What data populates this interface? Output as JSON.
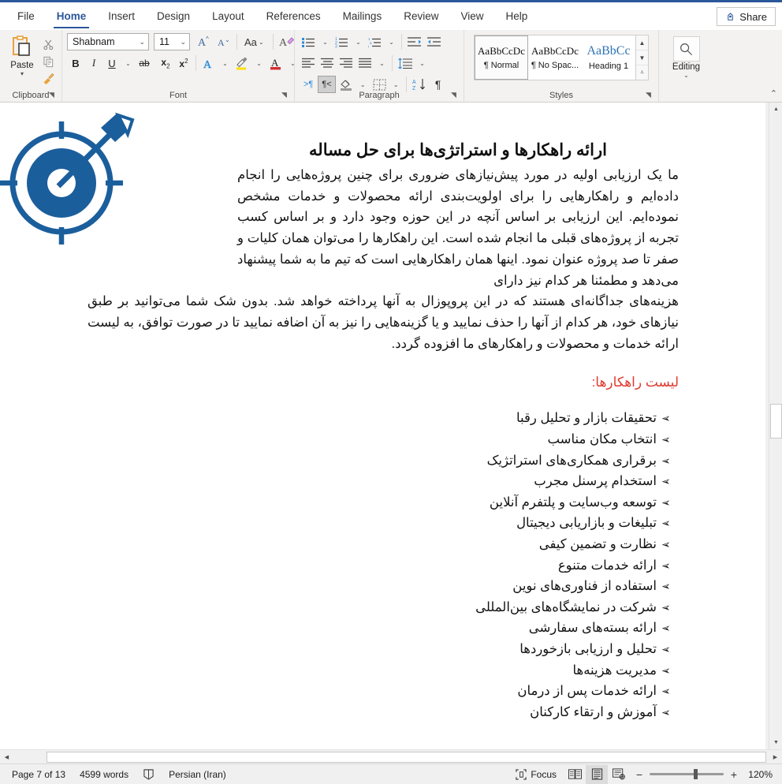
{
  "titlebar": {
    "tabs": [
      "File",
      "Home",
      "Insert",
      "Design",
      "Layout",
      "References",
      "Mailings",
      "Review",
      "View",
      "Help"
    ],
    "active_tab": "Home",
    "share_label": "Share",
    "share_icon": "share-person-icon"
  },
  "ribbon": {
    "groups": [
      {
        "name": "Clipboard",
        "label": "Clipboard",
        "paste_label": "Paste",
        "paste_icon": "clipboard-paste-icon",
        "cut_icon": "scissors-icon",
        "copy_icon": "copy-icon",
        "format_painter_icon": "paintbrush-icon",
        "dialog_launcher_icon": "dialog-launcher-icon"
      },
      {
        "name": "Font",
        "label": "Font",
        "font_name": "Shabnam",
        "font_size": "11",
        "grow_font_icon": "grow-font-icon",
        "shrink_font_icon": "shrink-font-icon",
        "change_case_label": "Aa",
        "change_case_icon": "change-case-icon",
        "clear_formatting_icon": "clear-formatting-icon",
        "bold_label": "B",
        "italic_label": "I",
        "underline_label": "U",
        "strikethrough_label": "ab",
        "subscript_label": "x",
        "subscript_sub": "2",
        "superscript_label": "x",
        "superscript_sup": "2",
        "text_effects_label": "A",
        "text_effects_icon": "text-effects-icon",
        "highlight_label": "A",
        "highlight_icon": "text-highlight-icon",
        "font_color_label": "A",
        "font_color_icon": "font-color-icon",
        "dialog_launcher_icon": "dialog-launcher-icon"
      },
      {
        "name": "Paragraph",
        "label": "Paragraph",
        "bullets_icon": "bullet-list-icon",
        "numbering_icon": "numbered-list-icon",
        "multilevel_icon": "multilevel-list-icon",
        "decrease_indent_icon": "decrease-indent-icon",
        "increase_indent_icon": "increase-indent-icon",
        "align_left_icon": "align-left-icon",
        "align_center_icon": "align-center-icon",
        "align_right_icon": "align-right-icon",
        "justify_icon": "justify-icon",
        "line_spacing_icon": "line-spacing-icon",
        "ltr_icon": "left-to-right-text-icon",
        "rtl_icon": "right-to-left-text-icon",
        "rtl_pressed": true,
        "shading_icon": "shading-icon",
        "borders_icon": "borders-icon",
        "sort_icon": "sort-az-icon",
        "show_marks_icon": "show-formatting-marks-icon",
        "dialog_launcher_icon": "dialog-launcher-icon"
      },
      {
        "name": "Styles",
        "label": "Styles",
        "items": [
          {
            "preview": "AaBbCcDc",
            "name": "¶ Normal",
            "selected": true
          },
          {
            "preview": "AaBbCcDc",
            "name": "¶ No Spac...",
            "selected": false
          },
          {
            "preview": "AaBbCc",
            "name": "Heading 1",
            "selected": false
          }
        ],
        "scroll_up_icon": "chevron-up-icon",
        "scroll_down_icon": "chevron-down-icon",
        "more_icon": "gallery-more-icon",
        "dialog_launcher_icon": "dialog-launcher-icon"
      },
      {
        "name": "Editing",
        "label": "Editing",
        "icon": "magnifier-icon",
        "dropdown_icon": "chevron-down-icon"
      }
    ],
    "collapse_icon": "collapse-ribbon-icon"
  },
  "document": {
    "title": "ارائه راهکارها و استراتژی‌ها برای حل مساله",
    "image_alt": "target-with-arrow-graphic",
    "image_color": "#1b5e9c",
    "paragraph_wrapped": "ما یک ارزیابی اولیه در مورد پیش‌نیازهای ضروری برای چنین پروژه‌هایی را انجام داده‌ایم و راهکارهایی را برای اولویت‌بندی ارائه محصولات و خدمات مشخص نموده‌ایم. این ارزیابی بر اساس آنچه در این حوزه وجود دارد و بر اساس کسب تجربه از پروژه‌های قبلی ما انجام شده است. این راهکارها را می‌توان همان کلیات و صفر تا صد پروژه عنوان نمود. اینها همان راهکارهایی است که تیم ما به شما پیشنهاد می‌دهد و مطمئنا هر کدام نیز دارای",
    "paragraph_full": "هزینه‌های جداگانه‌ای هستند که در این پروپوزال به آنها پرداخته خواهد شد. بدون شک شما می‌توانید بر طبق نیازهای خود، هر کدام از آنها را حذف نمایید و یا گزینه‌هایی را نیز به آن اضافه نمایید تا در صورت توافق، به لیست ارائه خدمات و محصولات و راهکارهای ما افزوده گردد.",
    "list_heading": "لیست راهکارها:",
    "list_heading_color": "#e03a2f",
    "bullet_marker": "➢",
    "bullets": [
      "تحقیقات بازار و تحلیل رقبا",
      "انتخاب مکان مناسب",
      "برقراری همکاری‌های استراتژیک",
      "استخدام پرسنل مجرب",
      "توسعه وب‌سایت و پلتفرم آنلاین",
      "تبلیغات و بازاریابی دیجیتال",
      "نظارت و تضمین کیفی",
      "ارائه خدمات متنوع",
      "استفاده از فناوری‌های نوین",
      "شرکت در نمایشگاه‌های بین‌المللی",
      "ارائه بسته‌های سفارشی",
      "تحلیل و ارزیابی بازخوردها",
      "مدیریت هزینه‌ها",
      "ارائه خدمات پس از درمان",
      "آموزش و ارتقاء کارکنان"
    ]
  },
  "scrollbars": {
    "v_up_icon": "scroll-up-arrow-icon",
    "v_down_icon": "scroll-down-arrow-icon",
    "v_split_icon": "split-window-icon",
    "h_left_icon": "scroll-left-arrow-icon",
    "h_right_icon": "scroll-right-arrow-icon"
  },
  "statusbar": {
    "page": "Page 7 of 13",
    "words": "4599 words",
    "proofing_icon": "proofing-errors-icon",
    "language": "Persian (Iran)",
    "focus_label": "Focus",
    "focus_icon": "focus-mode-icon",
    "view_read_icon": "read-mode-icon",
    "view_print_icon": "print-layout-icon",
    "view_web_icon": "web-layout-icon",
    "active_view": "print-layout",
    "zoom_out_label": "−",
    "zoom_in_label": "+",
    "zoom_percent": "120%"
  }
}
